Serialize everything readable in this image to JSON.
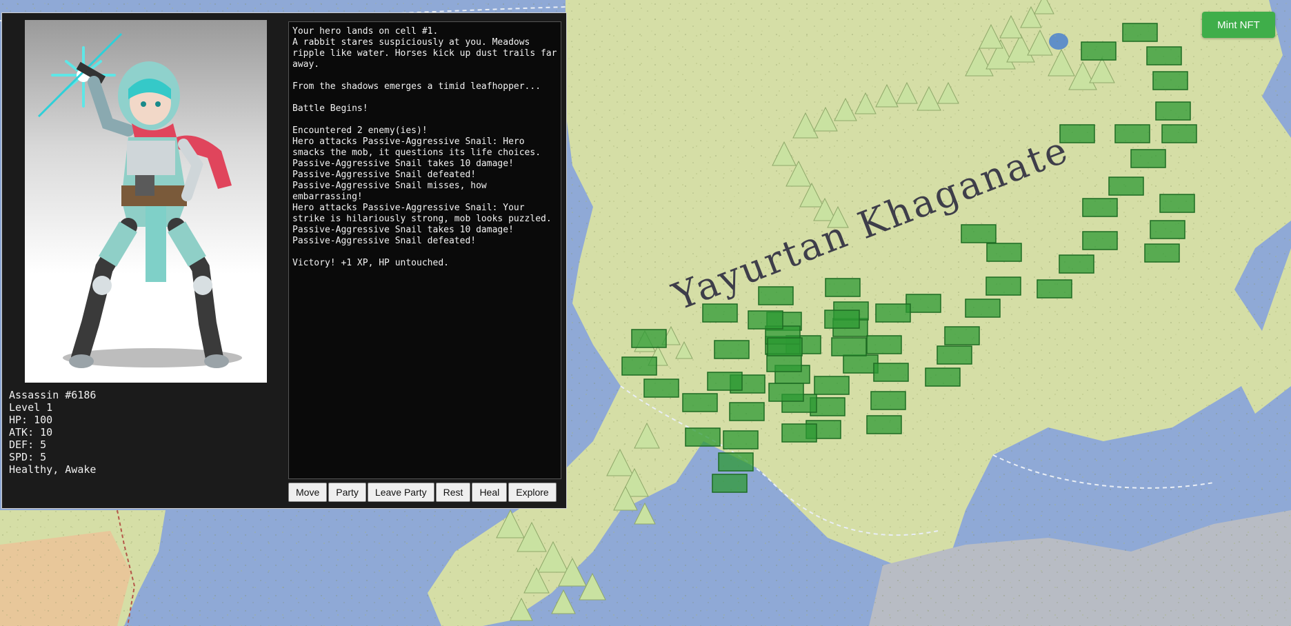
{
  "map": {
    "region_name": "Yayurtan Khaganate",
    "colors": {
      "land": "#d5dea6",
      "water": "#8fa9d6",
      "mountain": "#c7dfa0",
      "cell": "#2e9a34"
    },
    "cells_count": 64
  },
  "header": {
    "mint_label": "Mint NFT"
  },
  "hero": {
    "name": "Assassin #6186",
    "level": "Level 1",
    "hp": "HP: 100",
    "atk": "ATK: 10",
    "def": "DEF: 5",
    "spd": "SPD: 5",
    "status": "Healthy, Awake"
  },
  "log": [
    "Your hero lands on cell #1.",
    "A rabbit stares suspiciously at you. Meadows ripple like water. Horses kick up dust trails far away.",
    "",
    "From the shadows emerges a timid leafhopper...",
    "",
    "Battle Begins!",
    "",
    "Encountered 2 enemy(ies)!",
    "Hero attacks Passive-Aggressive Snail: Hero smacks the mob, it questions its life choices.",
    "Passive-Aggressive Snail takes 10 damage!",
    "Passive-Aggressive Snail defeated!",
    "Passive-Aggressive Snail misses, how embarrassing!",
    "Hero attacks Passive-Aggressive Snail: Your strike is hilariously strong, mob looks puzzled.",
    "Passive-Aggressive Snail takes 10 damage!",
    "Passive-Aggressive Snail defeated!",
    "",
    "Victory! +1 XP, HP untouched."
  ],
  "actions": [
    "Move",
    "Party",
    "Leave Party",
    "Rest",
    "Heal",
    "Explore"
  ]
}
